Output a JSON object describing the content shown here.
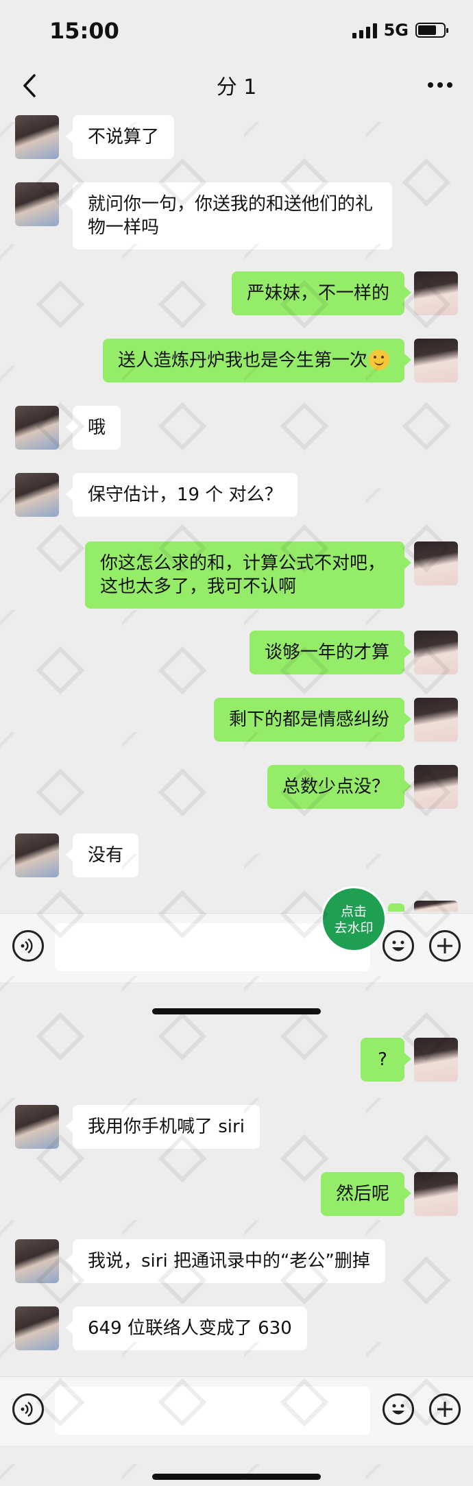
{
  "status_bar": {
    "time": "15:00",
    "network": "5G"
  },
  "header": {
    "title": "分 1"
  },
  "watermark_button": {
    "line1": "点击",
    "line2": "去水印"
  },
  "screen1": {
    "messages": [
      {
        "side": "in",
        "text": "不说算了"
      },
      {
        "side": "in",
        "text": "就问你一句，你送我的和送他们的礼\n物一样吗"
      },
      {
        "side": "out",
        "text": "严妹妹，不一样的"
      },
      {
        "side": "out",
        "text": "送人造炼丹炉我也是今生第一次",
        "emoji": "smile-emoji"
      },
      {
        "side": "in",
        "text": "哦"
      },
      {
        "side": "in",
        "text": "保守估计，19 个 对么？"
      },
      {
        "side": "out",
        "text": "你这怎么求的和，计算公式不对吧，\n这也太多了，我可不认啊"
      },
      {
        "side": "out",
        "text": "谈够一年的才算"
      },
      {
        "side": "out",
        "text": "剩下的都是情感纠纷"
      },
      {
        "side": "out",
        "text": "总数少点没？"
      },
      {
        "side": "in",
        "text": "没有"
      }
    ]
  },
  "screen2": {
    "messages": [
      {
        "side": "out",
        "text": "?"
      },
      {
        "side": "in",
        "text": "我用你手机喊了 siri"
      },
      {
        "side": "out",
        "text": "然后呢"
      },
      {
        "side": "in",
        "text": "我说，siri 把通讯录中的“老公”删掉"
      },
      {
        "side": "in",
        "text": "649 位联络人变成了 630"
      }
    ]
  },
  "icons": {
    "back": "chevron-left-icon",
    "more": "more-icon",
    "voice": "voice-icon",
    "emoji": "emoji-icon",
    "plus": "plus-icon"
  },
  "colors": {
    "background": "#ededed",
    "bubble_out": "#95ec69",
    "bubble_in": "#ffffff",
    "watermark_button": "#1f9f52"
  }
}
